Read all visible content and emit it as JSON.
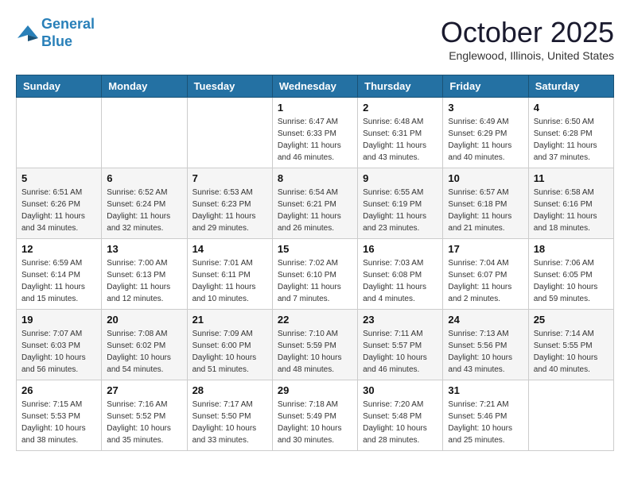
{
  "logo": {
    "line1": "General",
    "line2": "Blue"
  },
  "title": "October 2025",
  "location": "Englewood, Illinois, United States",
  "weekdays": [
    "Sunday",
    "Monday",
    "Tuesday",
    "Wednesday",
    "Thursday",
    "Friday",
    "Saturday"
  ],
  "weeks": [
    [
      {
        "day": "",
        "info": ""
      },
      {
        "day": "",
        "info": ""
      },
      {
        "day": "",
        "info": ""
      },
      {
        "day": "1",
        "info": "Sunrise: 6:47 AM\nSunset: 6:33 PM\nDaylight: 11 hours\nand 46 minutes."
      },
      {
        "day": "2",
        "info": "Sunrise: 6:48 AM\nSunset: 6:31 PM\nDaylight: 11 hours\nand 43 minutes."
      },
      {
        "day": "3",
        "info": "Sunrise: 6:49 AM\nSunset: 6:29 PM\nDaylight: 11 hours\nand 40 minutes."
      },
      {
        "day": "4",
        "info": "Sunrise: 6:50 AM\nSunset: 6:28 PM\nDaylight: 11 hours\nand 37 minutes."
      }
    ],
    [
      {
        "day": "5",
        "info": "Sunrise: 6:51 AM\nSunset: 6:26 PM\nDaylight: 11 hours\nand 34 minutes."
      },
      {
        "day": "6",
        "info": "Sunrise: 6:52 AM\nSunset: 6:24 PM\nDaylight: 11 hours\nand 32 minutes."
      },
      {
        "day": "7",
        "info": "Sunrise: 6:53 AM\nSunset: 6:23 PM\nDaylight: 11 hours\nand 29 minutes."
      },
      {
        "day": "8",
        "info": "Sunrise: 6:54 AM\nSunset: 6:21 PM\nDaylight: 11 hours\nand 26 minutes."
      },
      {
        "day": "9",
        "info": "Sunrise: 6:55 AM\nSunset: 6:19 PM\nDaylight: 11 hours\nand 23 minutes."
      },
      {
        "day": "10",
        "info": "Sunrise: 6:57 AM\nSunset: 6:18 PM\nDaylight: 11 hours\nand 21 minutes."
      },
      {
        "day": "11",
        "info": "Sunrise: 6:58 AM\nSunset: 6:16 PM\nDaylight: 11 hours\nand 18 minutes."
      }
    ],
    [
      {
        "day": "12",
        "info": "Sunrise: 6:59 AM\nSunset: 6:14 PM\nDaylight: 11 hours\nand 15 minutes."
      },
      {
        "day": "13",
        "info": "Sunrise: 7:00 AM\nSunset: 6:13 PM\nDaylight: 11 hours\nand 12 minutes."
      },
      {
        "day": "14",
        "info": "Sunrise: 7:01 AM\nSunset: 6:11 PM\nDaylight: 11 hours\nand 10 minutes."
      },
      {
        "day": "15",
        "info": "Sunrise: 7:02 AM\nSunset: 6:10 PM\nDaylight: 11 hours\nand 7 minutes."
      },
      {
        "day": "16",
        "info": "Sunrise: 7:03 AM\nSunset: 6:08 PM\nDaylight: 11 hours\nand 4 minutes."
      },
      {
        "day": "17",
        "info": "Sunrise: 7:04 AM\nSunset: 6:07 PM\nDaylight: 11 hours\nand 2 minutes."
      },
      {
        "day": "18",
        "info": "Sunrise: 7:06 AM\nSunset: 6:05 PM\nDaylight: 10 hours\nand 59 minutes."
      }
    ],
    [
      {
        "day": "19",
        "info": "Sunrise: 7:07 AM\nSunset: 6:03 PM\nDaylight: 10 hours\nand 56 minutes."
      },
      {
        "day": "20",
        "info": "Sunrise: 7:08 AM\nSunset: 6:02 PM\nDaylight: 10 hours\nand 54 minutes."
      },
      {
        "day": "21",
        "info": "Sunrise: 7:09 AM\nSunset: 6:00 PM\nDaylight: 10 hours\nand 51 minutes."
      },
      {
        "day": "22",
        "info": "Sunrise: 7:10 AM\nSunset: 5:59 PM\nDaylight: 10 hours\nand 48 minutes."
      },
      {
        "day": "23",
        "info": "Sunrise: 7:11 AM\nSunset: 5:57 PM\nDaylight: 10 hours\nand 46 minutes."
      },
      {
        "day": "24",
        "info": "Sunrise: 7:13 AM\nSunset: 5:56 PM\nDaylight: 10 hours\nand 43 minutes."
      },
      {
        "day": "25",
        "info": "Sunrise: 7:14 AM\nSunset: 5:55 PM\nDaylight: 10 hours\nand 40 minutes."
      }
    ],
    [
      {
        "day": "26",
        "info": "Sunrise: 7:15 AM\nSunset: 5:53 PM\nDaylight: 10 hours\nand 38 minutes."
      },
      {
        "day": "27",
        "info": "Sunrise: 7:16 AM\nSunset: 5:52 PM\nDaylight: 10 hours\nand 35 minutes."
      },
      {
        "day": "28",
        "info": "Sunrise: 7:17 AM\nSunset: 5:50 PM\nDaylight: 10 hours\nand 33 minutes."
      },
      {
        "day": "29",
        "info": "Sunrise: 7:18 AM\nSunset: 5:49 PM\nDaylight: 10 hours\nand 30 minutes."
      },
      {
        "day": "30",
        "info": "Sunrise: 7:20 AM\nSunset: 5:48 PM\nDaylight: 10 hours\nand 28 minutes."
      },
      {
        "day": "31",
        "info": "Sunrise: 7:21 AM\nSunset: 5:46 PM\nDaylight: 10 hours\nand 25 minutes."
      },
      {
        "day": "",
        "info": ""
      }
    ]
  ]
}
